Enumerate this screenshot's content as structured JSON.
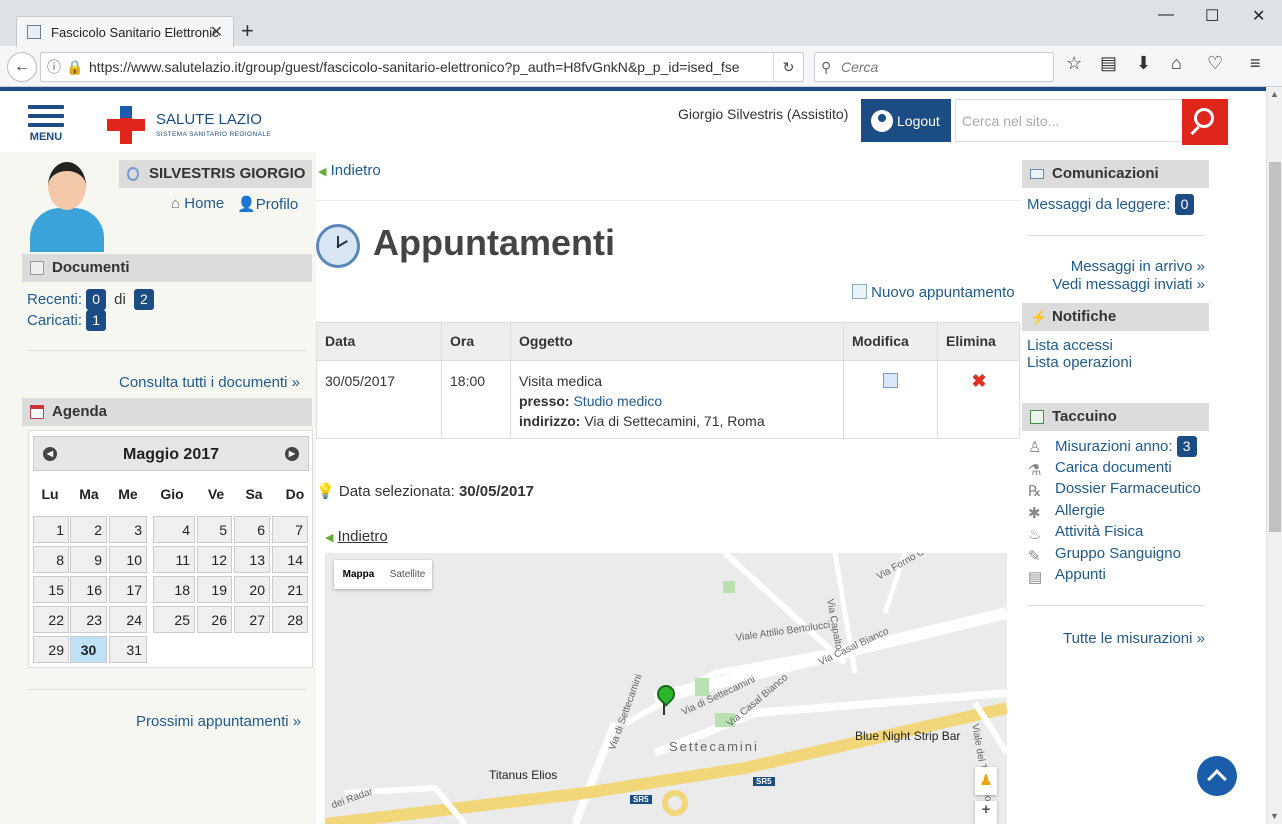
{
  "browser": {
    "tab_title": "Fascicolo Sanitario Elettronic",
    "url": "https://www.salutelazio.it/group/guest/fascicolo-sanitario-elettronico?p_auth=H8fvGnkN&p_p_id=ised_fse",
    "search_placeholder": "Cerca"
  },
  "header": {
    "menu_label": "MENU",
    "logo_title": "SALUTE LAZIO",
    "logo_subtitle": "SISTEMA SANITARIO REGIONALE",
    "user_name": "Giorgio Silvestris (Assistito)",
    "logout_label": "Logout",
    "site_search_placeholder": "Cerca nel sito..."
  },
  "left": {
    "patient_name": "SILVESTRIS GIORGIO",
    "home_label": "Home",
    "profile_label": "Profilo",
    "documents": {
      "title": "Documenti",
      "recent_label": "Recenti:",
      "recent_count": "0",
      "of_label": "di",
      "total_count": "2",
      "uploaded_label": "Caricati:",
      "uploaded_count": "1",
      "all_link": "Consulta tutti i documenti »"
    },
    "agenda": {
      "title": "Agenda",
      "month": "Maggio 2017",
      "weekdays": [
        "Lu",
        "Ma",
        "Me",
        "Gio",
        "Ve",
        "Sa",
        "Do"
      ],
      "selected_day": "30",
      "next_link": "Prossimi appuntamenti »"
    }
  },
  "main": {
    "back_label": "Indietro",
    "page_title": "Appuntamenti",
    "new_appointment": "Nuovo appuntamento",
    "table": {
      "headers": [
        "Data",
        "Ora",
        "Oggetto",
        "Modifica",
        "Elimina"
      ],
      "row": {
        "date": "30/05/2017",
        "time": "18:00",
        "subject": "Visita medica",
        "presso_label": "presso:",
        "presso_value": "Studio medico",
        "address_label": "indirizzo:",
        "address_value": "Via di Settecamini, 71, Roma"
      }
    },
    "selected_date_label": "Data selezionata:",
    "selected_date": "30/05/2017",
    "back_label2": "Indietro",
    "map": {
      "type_map": "Mappa",
      "type_satellite": "Satellite",
      "labels": [
        "Via Forno Casale",
        "Via Capalto",
        "Viale Attilio Bertolucci",
        "Via Casal Bianco",
        "Via di Settecamini",
        "Via Casal Bianco",
        "Via di Settecamini",
        "Settecamini",
        "Blue Night Strip Bar",
        "Viale del Tecnopolo",
        "Titanus Elios",
        "SR5",
        "SR5",
        "dei Radar"
      ],
      "zoom_in": "+"
    }
  },
  "right": {
    "comms_title": "Comunicazioni",
    "unread_label": "Messaggi da leggere:",
    "unread_count": "0",
    "inbox_link": "Messaggi in arrivo »",
    "sent_link": "Vedi messaggi inviati »",
    "notif_title": "Notifiche",
    "access_list": "Lista accessi",
    "ops_list": "Lista operazioni",
    "taccuino_title": "Taccuino",
    "measures_label": "Misurazioni anno:",
    "measures_count": "3",
    "items": [
      "Carica documenti",
      "Dossier Farmaceutico",
      "Allergie",
      "Attività Fisica",
      "Gruppo Sanguigno",
      "Appunti"
    ],
    "all_measures": "Tutte le misurazioni »"
  },
  "colors": {
    "brand_blue": "#1c4c84",
    "brand_red": "#e0261b",
    "link_blue": "#1f5a8c",
    "selected_day": "#bfe1f6"
  }
}
